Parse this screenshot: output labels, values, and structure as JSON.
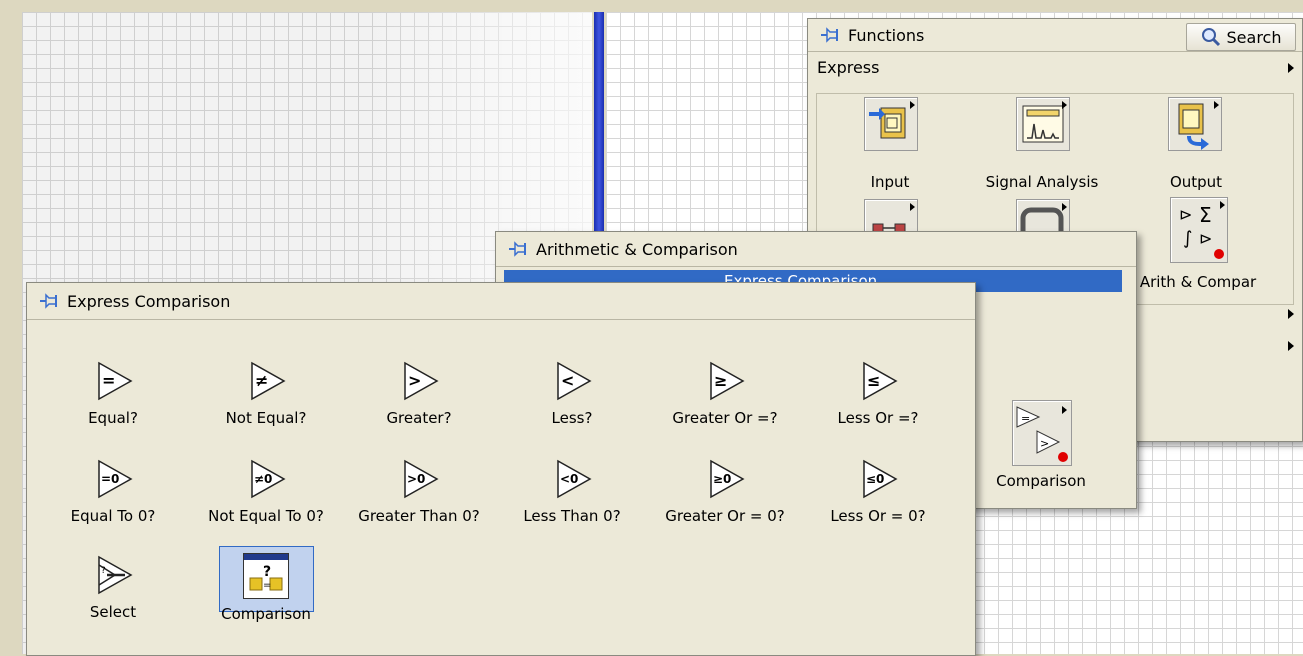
{
  "functions_palette": {
    "title": "Functions",
    "search_label": "Search",
    "category": "Express",
    "items": [
      {
        "label": "Input"
      },
      {
        "label": "Signal Analysis"
      },
      {
        "label": "Output"
      },
      {
        "label": "Arith & Compar"
      }
    ]
  },
  "arith_palette": {
    "title": "Arithmetic & Comparison",
    "highlighted_row": "Express Comparison",
    "item_label": "Comparison"
  },
  "express_palette": {
    "title": "Express Comparison",
    "items": [
      {
        "label": "Equal?",
        "symbol": "="
      },
      {
        "label": "Not Equal?",
        "symbol": "≠"
      },
      {
        "label": "Greater?",
        "symbol": ">"
      },
      {
        "label": "Less?",
        "symbol": "<"
      },
      {
        "label": "Greater Or =?",
        "symbol": "≥"
      },
      {
        "label": "Less Or =?",
        "symbol": "≤"
      },
      {
        "label": "Equal To 0?",
        "symbol": "=0"
      },
      {
        "label": "Not Equal To 0?",
        "symbol": "≠0"
      },
      {
        "label": "Greater Than 0?",
        "symbol": ">0"
      },
      {
        "label": "Less Than 0?",
        "symbol": "<0"
      },
      {
        "label": "Greater Or = 0?",
        "symbol": "≥0"
      },
      {
        "label": "Less Or = 0?",
        "symbol": "≤0"
      },
      {
        "label": "Select",
        "symbol": "select"
      },
      {
        "label": "Comparison",
        "symbol": "?",
        "selected": true
      }
    ]
  }
}
